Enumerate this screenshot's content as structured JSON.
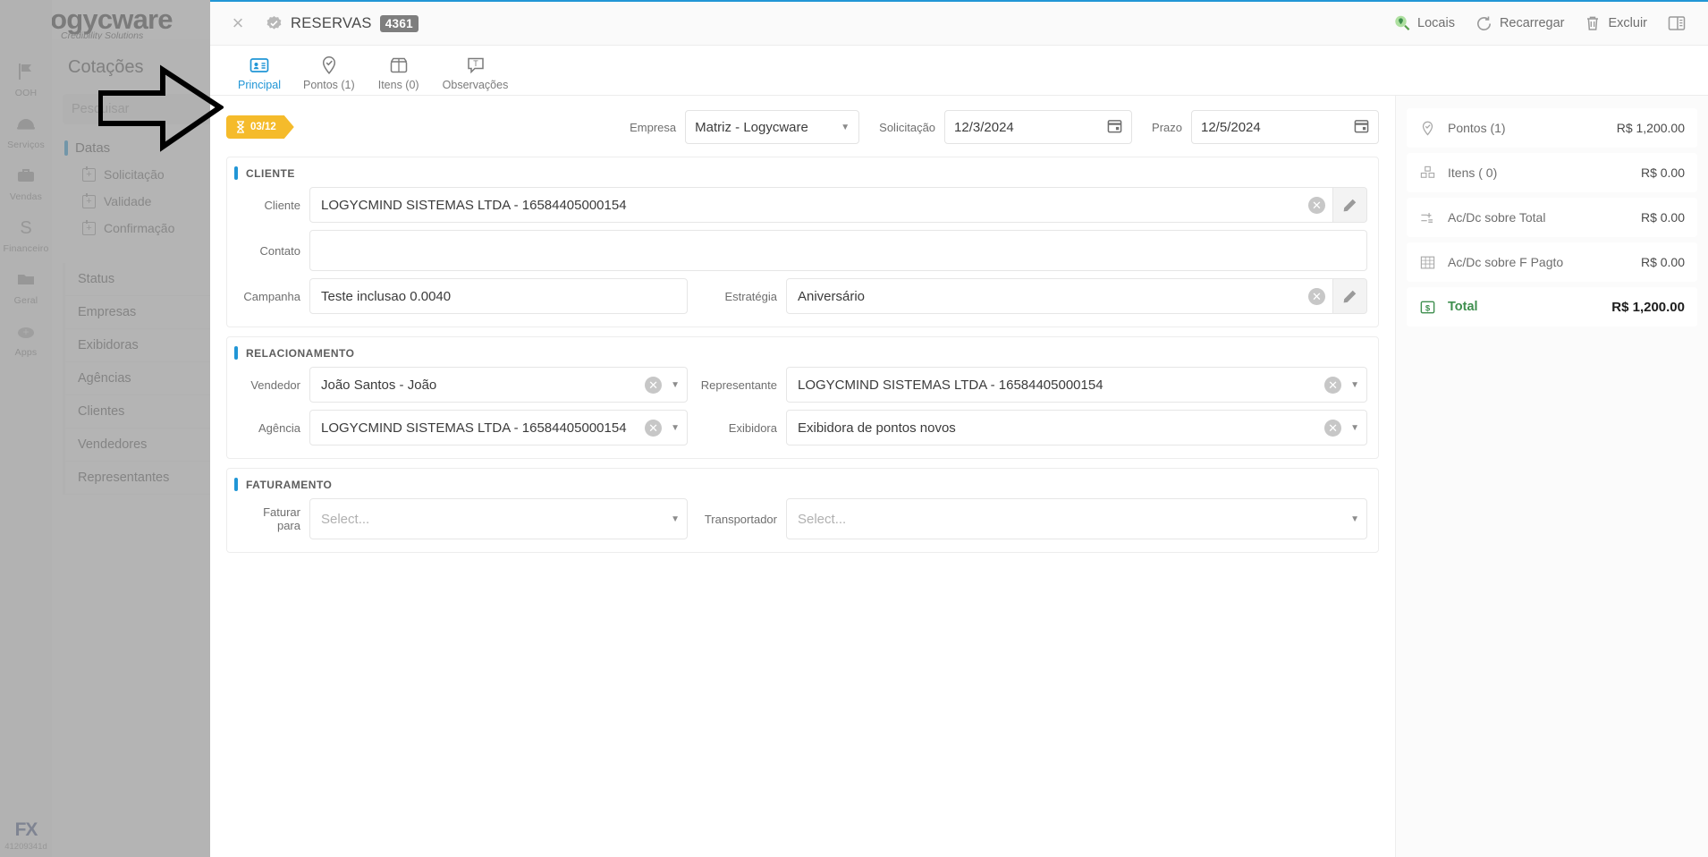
{
  "brand": {
    "name": "Logycware",
    "tagline": "Credibility Solutions",
    "accent": "#2196d6",
    "warn": "#f5bb2b",
    "green": "#3f8f4f"
  },
  "rail": {
    "items": [
      {
        "label": "OOH",
        "icon": "flag-icon"
      },
      {
        "label": "Serviços",
        "icon": "hardhat-icon"
      },
      {
        "label": "Vendas",
        "icon": "briefcase-icon"
      },
      {
        "label": "Financeiro",
        "icon": "dollar-icon"
      },
      {
        "label": "Geral",
        "icon": "folder-icon"
      },
      {
        "label": "Apps",
        "icon": "cloud-plus-icon"
      }
    ],
    "footer_logo": "FX",
    "build": "41209341d"
  },
  "bg_panel": {
    "title": "Cotações",
    "search_placeholder": "Pesquisar",
    "group_label": "Datas",
    "date_items": [
      {
        "label": "Solicitação"
      },
      {
        "label": "Validade"
      },
      {
        "label": "Confirmação"
      }
    ],
    "nav_items": [
      {
        "label": "Status"
      },
      {
        "label": "Empresas"
      },
      {
        "label": "Exibidoras"
      },
      {
        "label": "Agências"
      },
      {
        "label": "Clientes"
      },
      {
        "label": "Vendedores"
      },
      {
        "label": "Representantes"
      }
    ]
  },
  "modal": {
    "close_label": "×",
    "title": "RESERVAS",
    "count": "4361",
    "tools": [
      {
        "label": "Locais",
        "icon": "map-pin-search-icon"
      },
      {
        "label": "Recarregar",
        "icon": "refresh-icon"
      },
      {
        "label": "Excluir",
        "icon": "trash-icon"
      },
      {
        "label": "",
        "icon": "panel-toggle-icon"
      }
    ],
    "tabs": [
      {
        "label": "Principal",
        "icon": "id-card-icon",
        "active": true
      },
      {
        "label": "Pontos (1)",
        "icon": "map-pin-check-icon",
        "active": false
      },
      {
        "label": "Itens (0)",
        "icon": "box-icon",
        "active": false
      },
      {
        "label": "Observações",
        "icon": "text-comment-icon",
        "active": false
      }
    ]
  },
  "header_row": {
    "status_badge": {
      "icon": "hourglass-icon",
      "text": "03/12"
    },
    "empresa": {
      "label": "Empresa",
      "value": "Matriz  - Logycware"
    },
    "solicitacao": {
      "label": "Solicitação",
      "value": "12/3/2024",
      "icon": "calendar-icon"
    },
    "prazo": {
      "label": "Prazo",
      "value": "12/5/2024",
      "icon": "calendar-icon"
    }
  },
  "sections": {
    "cliente": {
      "title": "CLIENTE",
      "cliente": {
        "label": "Cliente",
        "value": "LOGYCMIND SISTEMAS LTDA - 16584405000154"
      },
      "contato": {
        "label": "Contato",
        "value": ""
      },
      "campanha": {
        "label": "Campanha",
        "value": "Teste inclusao 0.0040"
      },
      "estrategia": {
        "label": "Estratégia",
        "value": "Aniversário"
      }
    },
    "relacionamento": {
      "title": "RELACIONAMENTO",
      "vendedor": {
        "label": "Vendedor",
        "value": "João Santos - João"
      },
      "representante": {
        "label": "Representante",
        "value": "LOGYCMIND SISTEMAS LTDA - 16584405000154"
      },
      "agencia": {
        "label": "Agência",
        "value": "LOGYCMIND SISTEMAS LTDA - 16584405000154"
      },
      "exibidora": {
        "label": "Exibidora",
        "value": "Exibidora de pontos novos"
      }
    },
    "faturamento": {
      "title": "FATURAMENTO",
      "faturar_para": {
        "label": "Faturar para",
        "placeholder": "Select..."
      },
      "transportador": {
        "label": "Transportador",
        "placeholder": "Select..."
      }
    }
  },
  "summary": {
    "rows": [
      {
        "label": "Pontos (1)",
        "value": "R$ 1,200.00",
        "icon": "map-pin-check-icon"
      },
      {
        "label": "Itens ( 0)",
        "value": "R$ 0.00",
        "icon": "boxes-icon"
      },
      {
        "label": "Ac/Dc sobre Total",
        "value": "R$ 0.00",
        "icon": "calculator-icon"
      },
      {
        "label": "Ac/Dc sobre F Pagto",
        "value": "R$ 0.00",
        "icon": "grid-icon"
      }
    ],
    "total": {
      "label": "Total",
      "value": "R$ 1,200.00",
      "icon": "money-icon"
    }
  }
}
